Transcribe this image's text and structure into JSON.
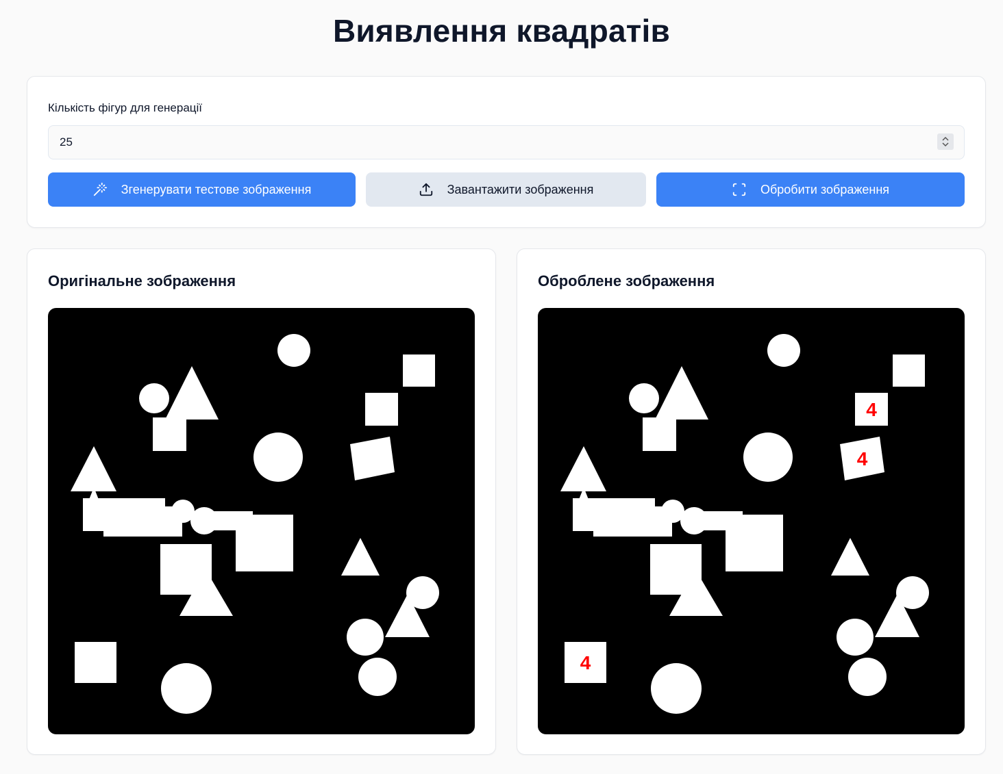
{
  "page": {
    "title": "Виявлення квадратів"
  },
  "controls": {
    "count_label": "Кількість фігур для генерації",
    "count_value": "25",
    "generate_label": "Згенерувати тестове зображення",
    "upload_label": "Завантажити зображення",
    "process_label": "Обробити зображення"
  },
  "panels": {
    "original_title": "Оригінальне зображення",
    "processed_title": "Оброблене зображення",
    "square_marker": "4"
  },
  "colors": {
    "primary": "#3b82f6",
    "secondary": "#e2e8f0",
    "marker": "#ff0000",
    "canvas_bg": "#000000",
    "shape": "#ffffff"
  },
  "icons": {
    "generate": "magic-wand-icon",
    "upload": "upload-icon",
    "process": "scan-frame-icon",
    "stepper": "chevron-up-down-icon"
  }
}
